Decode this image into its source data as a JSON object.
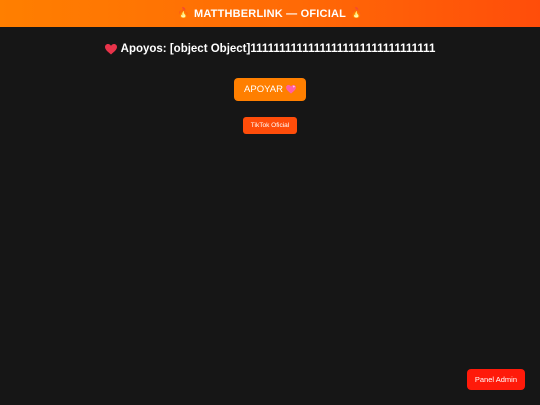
{
  "header": {
    "title": "MATTHBERLINK — OFICIAL",
    "left_icon": "🔥",
    "right_icon": "🔥",
    "gradient_start": "#ff7f00",
    "gradient_end": "#ff4d0a"
  },
  "counter": {
    "icon": "heart-icon",
    "text": "Apoyos: [object Object]11111111111111111111111111111111"
  },
  "support_button": {
    "label": "APOYAR",
    "icon": "sparkle-heart-icon",
    "color": "#ff7f00"
  },
  "tiktok_button": {
    "label": "TikTok Oficial",
    "color": "#ff4d0a"
  },
  "admin_button": {
    "label": "Panel Admin",
    "color": "#ff1a0a"
  },
  "theme": {
    "background": "#161616",
    "text": "#ffffff"
  }
}
